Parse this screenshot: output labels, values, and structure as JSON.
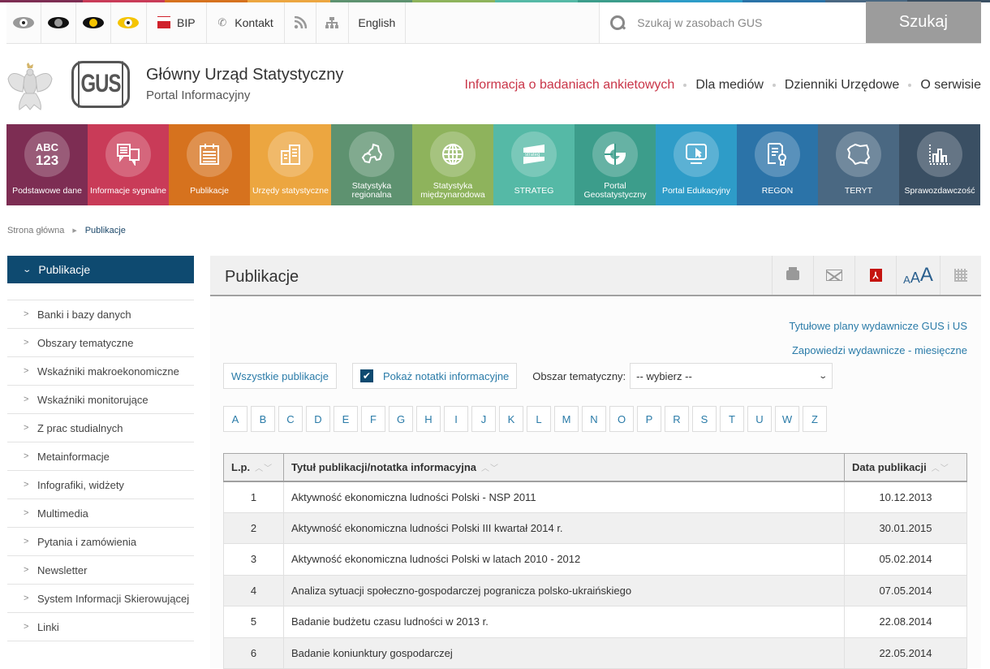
{
  "colors": {
    "strip": [
      "#7d2d53",
      "#c93b58",
      "#d6721e",
      "#eca640",
      "#5e9270",
      "#8eb35c",
      "#55b9a6",
      "#3c9d8b",
      "#2e9cc8",
      "#2b73a8",
      "#4a6882",
      "#3a4f63"
    ],
    "tiles": [
      "#7d2d53",
      "#c93b58",
      "#d6721e",
      "#eca640",
      "#5e9270",
      "#8eb35c",
      "#55b9a6",
      "#3c9d8b",
      "#2e9cc8",
      "#2b73a8",
      "#4a6882",
      "#3a4f63"
    ],
    "accent": "#0e4a70",
    "link": "#2a7ba8",
    "highlight_nav": "#c93548"
  },
  "topbar": {
    "contrast_options": [
      "contrast-default",
      "contrast-black-white",
      "contrast-black-yellow",
      "contrast-yellow-black"
    ],
    "bip": "BIP",
    "kontakt": "Kontakt",
    "english": "English",
    "search_placeholder": "Szukaj w zasobach GUS",
    "search_button": "Szukaj"
  },
  "header": {
    "title": "Główny Urząd Statystyczny",
    "subtitle": "Portal Informacyjny",
    "logo_text": "GUS",
    "nav": [
      {
        "label": "Informacja o badaniach ankietowych",
        "highlighted": true
      },
      {
        "label": "Dla mediów",
        "highlighted": false
      },
      {
        "label": "Dzienniki Urzędowe",
        "highlighted": false
      },
      {
        "label": "O serwisie",
        "highlighted": false
      }
    ]
  },
  "tiles": [
    {
      "label": "Podstawowe dane",
      "icon": "abc-123-icon",
      "icon_text_1": "ABC",
      "icon_text_2": "123"
    },
    {
      "label": "Informacje sygnalne",
      "icon": "speech-bubbles-icon"
    },
    {
      "label": "Publikacje",
      "icon": "calendar-list-icon"
    },
    {
      "label": "Urzędy statystyczne",
      "icon": "buildings-icon"
    },
    {
      "label": "Statystyka regionalna",
      "icon": "regions-map-icon"
    },
    {
      "label": "Statystyka międzynarodowa",
      "icon": "globe-icon"
    },
    {
      "label": "STRATEG",
      "icon": "strateg-icon",
      "icon_text_1": "strateg"
    },
    {
      "label": "Portal Geostatystyczny",
      "icon": "geo-g-icon"
    },
    {
      "label": "Portal Edukacyjny",
      "icon": "monitor-cursor-icon"
    },
    {
      "label": "REGON",
      "icon": "document-key-icon"
    },
    {
      "label": "TERYT",
      "icon": "poland-map-icon"
    },
    {
      "label": "Sprawozdawczość",
      "icon": "bar-chart-icon"
    }
  ],
  "breadcrumb": {
    "home": "Strona główna",
    "current": "Publikacje"
  },
  "sidebar": {
    "active": "Publikacje",
    "items": [
      {
        "label": "Banki i bazy danych"
      },
      {
        "label": "Obszary tematyczne"
      },
      {
        "label": "Wskaźniki makroekonomiczne"
      },
      {
        "label": "Wskaźniki monitorujące"
      },
      {
        "label": "Z prac studialnych"
      },
      {
        "label": "Metainformacje"
      },
      {
        "label": "Infografiki, widżety"
      },
      {
        "label": "Multimedia"
      },
      {
        "label": "Pytania i zamówienia"
      },
      {
        "label": "Newsletter"
      },
      {
        "label": "System Informacji Skierowującej"
      },
      {
        "label": "Linki"
      }
    ]
  },
  "main": {
    "title": "Publikacje",
    "tools": {
      "pdf_glyph": "⅄",
      "font_small": "A",
      "font_medium": "A",
      "font_large": "A"
    },
    "links": [
      "Tytułowe plany wydawnicze GUS i  US",
      "Zapowiedzi wydawnicze - miesięczne"
    ],
    "filters": {
      "all_button": "Wszystkie publikacje",
      "show_notes_label": "Pokaż notatki informacyjne",
      "show_notes_checked": true,
      "topic_label": "Obszar tematyczny:",
      "topic_selected": "-- wybierz --"
    },
    "letters": [
      "A",
      "B",
      "C",
      "D",
      "E",
      "F",
      "G",
      "H",
      "I",
      "J",
      "K",
      "L",
      "M",
      "N",
      "O",
      "P",
      "R",
      "S",
      "T",
      "U",
      "W",
      "Z"
    ],
    "table": {
      "headers": [
        "L.p.",
        "Tytuł publikacji/notatka informacyjna",
        "Data publikacji"
      ],
      "sort_glyph": "︿﹀",
      "rows": [
        {
          "lp": "1",
          "title": "Aktywność ekonomiczna ludności Polski - NSP 2011",
          "date": "10.12.2013"
        },
        {
          "lp": "2",
          "title": "Aktywność ekonomiczna ludności Polski III kwartał 2014 r.",
          "date": "30.01.2015"
        },
        {
          "lp": "3",
          "title": "Aktywność ekonomiczna ludności Polski w latach 2010 - 2012",
          "date": "05.02.2014"
        },
        {
          "lp": "4",
          "title": "Analiza sytuacji społeczno-gospodarczej pogranicza polsko-ukraińskiego",
          "date": "07.05.2014"
        },
        {
          "lp": "5",
          "title": "Badanie budżetu czasu ludności w 2013 r.",
          "date": "22.08.2014"
        },
        {
          "lp": "6",
          "title": "Badanie koniunktury gospodarczej",
          "date": "22.05.2014"
        }
      ]
    }
  }
}
